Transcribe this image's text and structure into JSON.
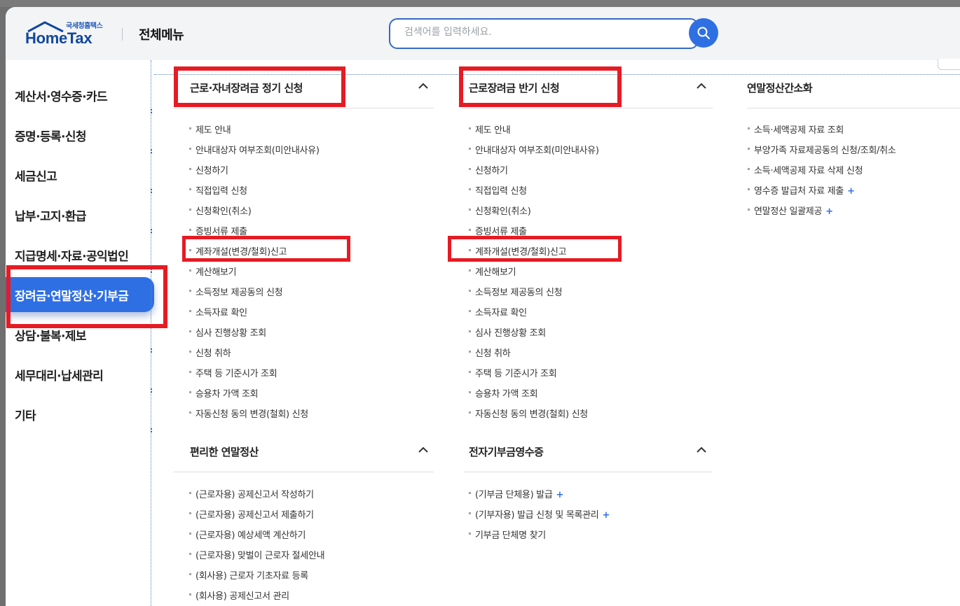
{
  "header": {
    "logo_small": "국세청홈택스",
    "logo_main": "HomeTax",
    "title": "전체메뉴",
    "search_placeholder": "검색어를 입력하세요."
  },
  "sidebar": {
    "items": [
      {
        "label": "계산서·영수증·카드"
      },
      {
        "label": "증명·등록·신청"
      },
      {
        "label": "세금신고"
      },
      {
        "label": "납부·고지·환급"
      },
      {
        "label": "지급명세·자료·공익법인"
      },
      {
        "label": "장려금·연말정산·기부금",
        "active": true
      },
      {
        "label": "상담·불복·제보"
      },
      {
        "label": "세무대리·납세관리"
      },
      {
        "label": "기타"
      }
    ]
  },
  "sections": {
    "s1": {
      "title": "근로·자녀장려금 정기 신청",
      "items": [
        "제도 안내",
        "안내대상자 여부조회(미안내사유)",
        "신청하기",
        "직접입력 신청",
        "신청확인(취소)",
        "증빙서류 제출",
        "계좌개설(변경/철회)신고",
        "계산해보기",
        "소득정보 제공동의 신청",
        "소득자료 확인",
        "심사 진행상황 조회",
        "신청 취하",
        "주택 등 기준시가 조회",
        "승용차 가액 조회",
        "자동신청 동의 변경(철회) 신청"
      ]
    },
    "s2": {
      "title": "근로장려금 반기 신청",
      "items": [
        "제도 안내",
        "안내대상자 여부조회(미안내사유)",
        "신청하기",
        "직접입력 신청",
        "신청확인(취소)",
        "증빙서류 제출",
        "계좌개설(변경/철회)신고",
        "계산해보기",
        "소득정보 제공동의 신청",
        "소득자료 확인",
        "심사 진행상황 조회",
        "신청 취하",
        "주택 등 기준시가 조회",
        "승용차 가액 조회",
        "자동신청 동의 변경(철회) 신청"
      ]
    },
    "s3": {
      "title": "연말정산간소화",
      "items": [
        "소득·세액공제 자료 조회",
        "부양가족 자료제공동의 신청/조회/취소",
        "소득·세액공제 자료 삭제 신청",
        "영수증 발급처 자료 제출",
        "연말정산 일괄제공"
      ],
      "plus_flags": [
        false,
        false,
        false,
        true,
        true
      ]
    },
    "s4": {
      "title": "편리한 연말정산",
      "items": [
        "(근로자용) 공제신고서 작성하기",
        "(근로자용) 공제신고서 제출하기",
        "(근로자용) 예상세액 계산하기",
        "(근로자용) 맞벌이 근로자 절세안내",
        "(회사용) 근로자 기초자료 등록",
        "(회사용) 공제신고서 관리"
      ]
    },
    "s5": {
      "title": "전자기부금영수증",
      "items": [
        "(기부금 단체용) 발급",
        "(기부자용) 발급 신청 및 목록관리",
        "기부금 단체명 찾기"
      ],
      "plus_flags": [
        true,
        true,
        false
      ]
    }
  },
  "plus_symbol": "+",
  "colors": {
    "accent": "#2f6fe4",
    "highlight_box": "#e61b23",
    "logo": "#12479c"
  }
}
